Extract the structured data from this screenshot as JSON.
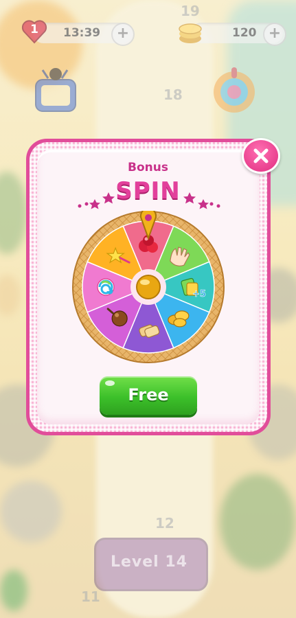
{
  "hud": {
    "lives": "1",
    "timer": "13:39",
    "coins": "120",
    "add_symbol": "+"
  },
  "map": {
    "level_numbers": [
      "19",
      "18",
      "12",
      "11"
    ],
    "current_level_label": "Level 14"
  },
  "modal": {
    "title_small": "Bonus",
    "title_big": "SPIN",
    "free_button_label": "Free",
    "wheel_segments": [
      {
        "icon": "jelly-candy-icon",
        "color": "#f06b8c"
      },
      {
        "icon": "hand-icon",
        "color": "#7ed957"
      },
      {
        "icon": "extra-moves-plus5-icon",
        "color": "#37c7c2",
        "label": "+5"
      },
      {
        "icon": "gold-coins-icon",
        "color": "#3cb5ef"
      },
      {
        "icon": "cookies-icon",
        "color": "#8e58d4"
      },
      {
        "icon": "chocolate-bomb-icon",
        "color": "#d45fd8"
      },
      {
        "icon": "swirl-candy-icon",
        "color": "#f07ad0"
      },
      {
        "icon": "star-wand-icon",
        "color": "#ffb224"
      }
    ]
  },
  "colors": {
    "modal_border": "#e14d9a",
    "title_pink": "#e2409b",
    "free_button_green": "#3cc02a",
    "close_button": "#e02e80"
  }
}
